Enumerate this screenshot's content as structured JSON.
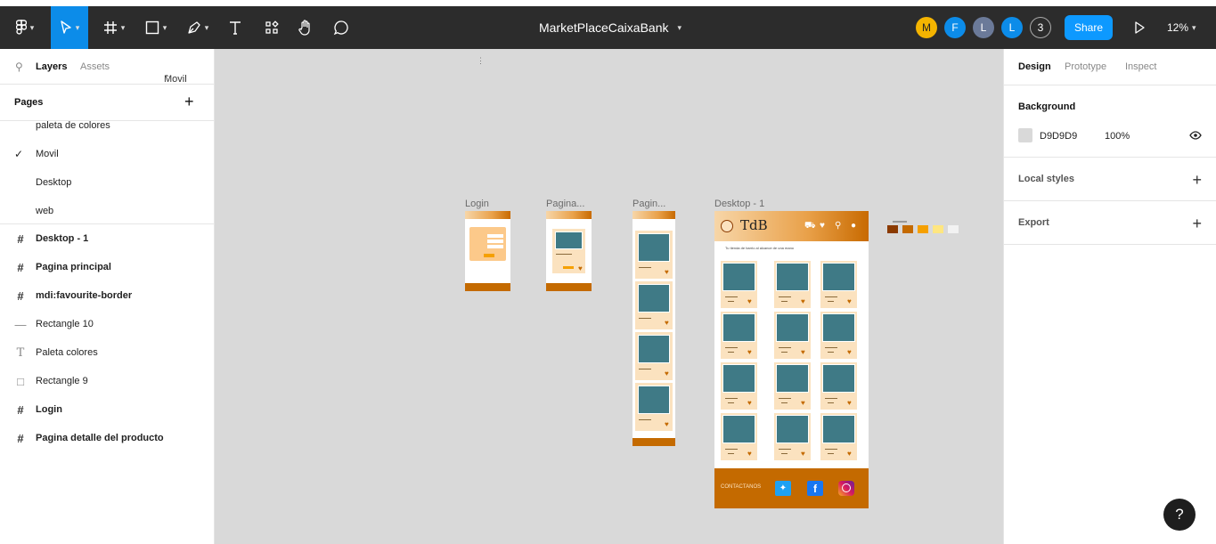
{
  "toolbar": {
    "title": "MarketPlaceCaixaBank",
    "avatars": [
      {
        "letter": "M",
        "color": "#f4b400",
        "text_color": "#222"
      },
      {
        "letter": "F",
        "color": "#0c8ce9",
        "text_color": "#fff"
      },
      {
        "letter": "L",
        "color": "#6b7a99",
        "text_color": "#fff"
      },
      {
        "letter": "L",
        "color": "#0c8ce9",
        "text_color": "#fff"
      },
      {
        "letter": "3",
        "color": "#2c2c2c",
        "text_color": "#fff"
      }
    ],
    "share_label": "Share",
    "zoom": "12%"
  },
  "left_panel": {
    "tabs": [
      "Layers",
      "Assets"
    ],
    "current_page": "Movil",
    "pages_title": "Pages",
    "pages": [
      "paleta de colores",
      "Movil",
      "Desktop",
      "web"
    ],
    "active_page": "Movil",
    "layers": [
      {
        "name": "Desktop - 1",
        "icon": "frame-icon",
        "bold": true
      },
      {
        "name": "Pagina principal",
        "icon": "frame-icon",
        "bold": true
      },
      {
        "name": "mdi:favourite-border",
        "icon": "frame-icon",
        "bold": true
      },
      {
        "name": "Rectangle 10",
        "icon": "line-icon",
        "bold": false
      },
      {
        "name": "Paleta colores",
        "icon": "text-icon",
        "bold": false
      },
      {
        "name": "Rectangle 9",
        "icon": "rectangle-icon",
        "bold": false
      },
      {
        "name": "Login",
        "icon": "frame-icon",
        "bold": true
      },
      {
        "name": "Pagina detalle del producto",
        "icon": "frame-icon",
        "bold": true
      }
    ]
  },
  "canvas": {
    "background": "#d9d9d9",
    "frames": {
      "login": "Login",
      "detail": "Pagina...",
      "principal": "Pagin...",
      "desktop": "Desktop - 1"
    },
    "desktop": {
      "logo": "TdB",
      "tagline": "Tu tienda de barrio al alcance de una mano",
      "footer": "CONTACTANOS"
    },
    "palette": [
      "#8b3a00",
      "#c46a00",
      "#f5a000",
      "#ffe680",
      "#f2f2f2"
    ]
  },
  "right_panel": {
    "tabs": [
      "Design",
      "Prototype",
      "Inspect"
    ],
    "background_title": "Background",
    "bg_hex": "D9D9D9",
    "bg_opacity": "100%",
    "local_styles": "Local styles",
    "export": "Export"
  },
  "help_label": "?"
}
